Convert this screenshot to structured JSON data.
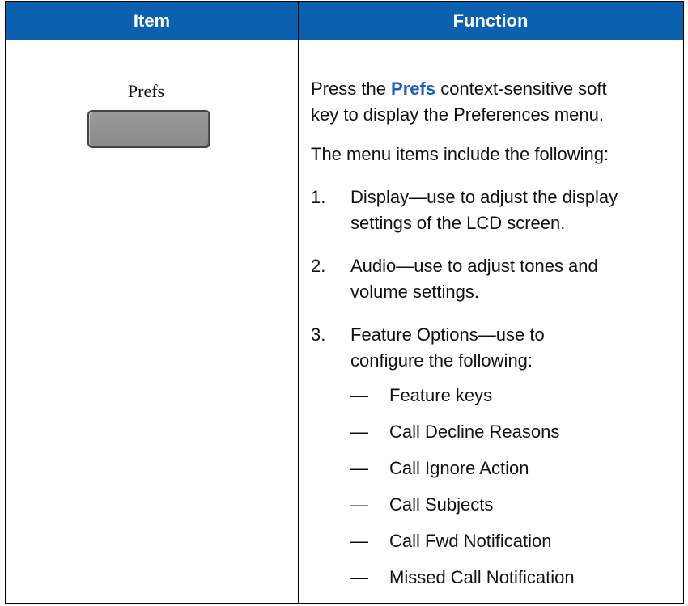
{
  "header": {
    "item_label": "Item",
    "function_label": "Function"
  },
  "item": {
    "softkey_label": "Prefs"
  },
  "function": {
    "intro_prefix": "Press the ",
    "intro_keyword": "Prefs",
    "intro_line1_suffix": " context-sensitive soft",
    "intro_line2": "key to display the Preferences menu.",
    "menu_intro": "The menu items include the following:",
    "items": [
      {
        "number": "1.",
        "line1": "Display—use to adjust the display",
        "line2": "settings of the LCD screen."
      },
      {
        "number": "2.",
        "line1": "Audio—use to adjust tones and",
        "line2": "volume settings."
      },
      {
        "number": "3.",
        "line1": "Feature Options—use to",
        "line2": "configure the following:"
      }
    ],
    "sub_items": [
      "Feature keys",
      "Call Decline Reasons",
      "Call Ignore Action",
      "Call Subjects",
      "Call Fwd Notification",
      "Missed Call Notification"
    ],
    "dash": "—"
  },
  "colors": {
    "header_bg": "#0b61ae",
    "keyword": "#1a5fb4"
  }
}
